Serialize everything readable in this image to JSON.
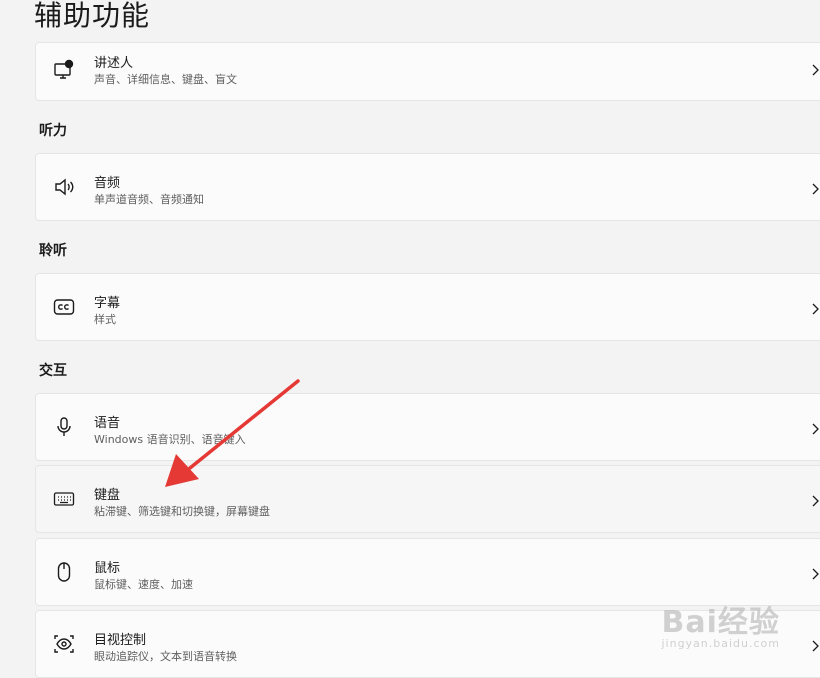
{
  "page": {
    "title": "辅助功能"
  },
  "sections": {
    "hearing": "听力",
    "listening": "聆听",
    "interaction": "交互"
  },
  "items": {
    "narrator": {
      "title": "讲述人",
      "sub": "声音、详细信息、键盘、盲文",
      "icon": "narrator-icon"
    },
    "audio": {
      "title": "音频",
      "sub": "单声道音频、音频通知",
      "icon": "speaker-icon"
    },
    "captions": {
      "title": "字幕",
      "sub": "样式",
      "icon": "captions-icon"
    },
    "speech": {
      "title": "语音",
      "sub": "Windows 语音识别、语音键入",
      "icon": "microphone-icon"
    },
    "keyboard": {
      "title": "键盘",
      "sub": "粘滞键、筛选键和切换键，屏幕键盘",
      "icon": "keyboard-icon"
    },
    "mouse": {
      "title": "鼠标",
      "sub": "鼠标键、速度、加速",
      "icon": "mouse-icon"
    },
    "eye_control": {
      "title": "目视控制",
      "sub": "眼动追踪仪，文本到语音转换",
      "icon": "eye-control-icon"
    }
  },
  "annotation": {
    "color": "#e53935"
  },
  "watermark": {
    "main": "Bai经验",
    "sub": "jingyan.baidu.com"
  }
}
